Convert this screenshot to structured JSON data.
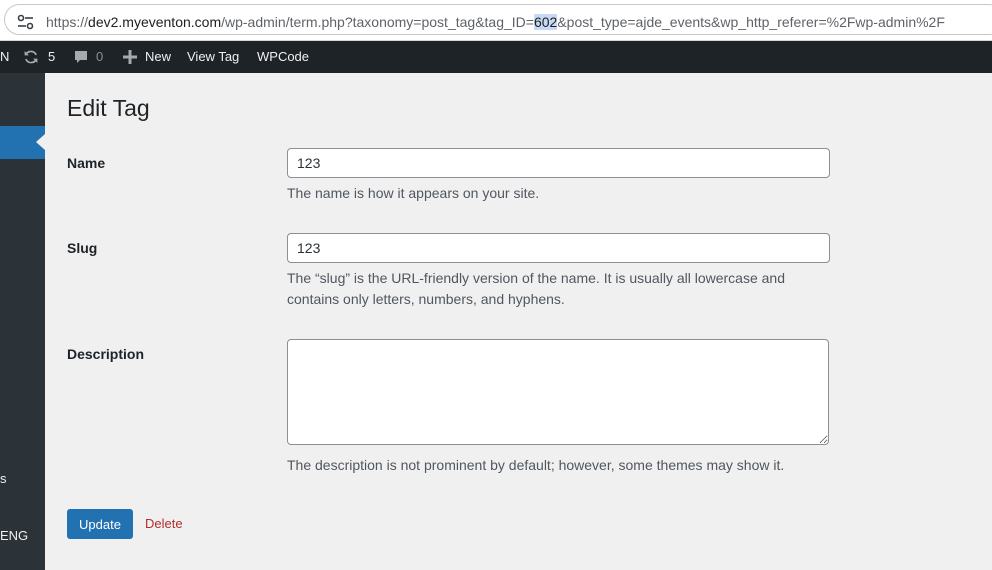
{
  "browser": {
    "url_prefix": "https://",
    "url_host": "dev2.myeventon.com",
    "url_path_before": "/wp-admin/term.php?taxonomy=post_tag&tag_ID=",
    "url_highlight": "602",
    "url_path_after": "&post_type=ajde_events&wp_http_referer=%2Fwp-admin%2F",
    "site_info_icon": "tune-icon"
  },
  "adminbar": {
    "left_fragment": "N",
    "updates_count": "5",
    "comments_count": "0",
    "new_label": "New",
    "view_tag_label": "View Tag",
    "wpcode_label": "WPCode"
  },
  "sidebar": {
    "fragment_s": "s",
    "fragment_eng": "ENG"
  },
  "page": {
    "title": "Edit Tag"
  },
  "form": {
    "name_label": "Name",
    "name_value": "123",
    "name_help": "The name is how it appears on your site.",
    "slug_label": "Slug",
    "slug_value": "123",
    "slug_help_line1": "The “slug” is the URL-friendly version of the name. It is usually all lowercase and",
    "slug_help_line2": "contains only letters, numbers, and hyphens.",
    "description_label": "Description",
    "description_value": "",
    "description_help": "The description is not prominent by default; however, some themes may show it.",
    "update_label": "Update",
    "delete_label": "Delete"
  },
  "colors": {
    "primary": "#2271b1",
    "adminbar_bg": "#1d2327",
    "menu_bg": "#2c3338",
    "delete": "#b32d2e",
    "page_bg": "#f0f0f1"
  }
}
